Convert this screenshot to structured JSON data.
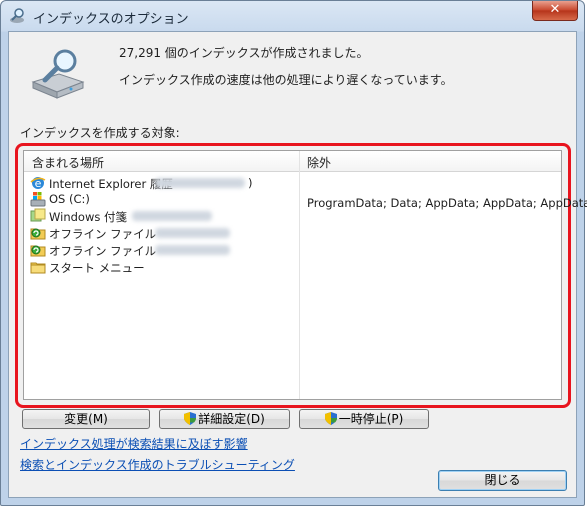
{
  "window": {
    "title": "インデックスのオプション",
    "close_label": "✕"
  },
  "summary": {
    "count_line": "27,291 個のインデックスが作成されました。",
    "speed_line": "インデックス作成の速度は他の処理により遅くなっています。"
  },
  "section_label": "インデックスを作成する対象:",
  "table": {
    "col_included": "含まれる場所",
    "col_excluded": "除外",
    "rows": [
      {
        "label": "Internet Explorer 履歴",
        "suffix": ")",
        "icon": "internet-explorer-icon"
      },
      {
        "label": "OS (C:)",
        "suffix": "",
        "icon": "windows-drive-icon",
        "excluded": "ProgramData; Data; AppData; AppData; AppData;..."
      },
      {
        "label": "Windows 付箋",
        "suffix": "",
        "icon": "sticky-notes-icon"
      },
      {
        "label": "オフライン ファイル",
        "suffix": "",
        "icon": "offline-files-icon"
      },
      {
        "label": "オフライン ファイル",
        "suffix": "",
        "icon": "offline-files-icon"
      },
      {
        "label": "スタート メニュー",
        "suffix": "",
        "icon": "folder-icon"
      }
    ]
  },
  "buttons": {
    "modify": "変更(M)",
    "advanced": "詳細設定(D)",
    "pause": "一時停止(P)",
    "close": "閉じる"
  },
  "links": {
    "effect": "インデックス処理が検索結果に及ぼす影響",
    "troubleshoot": "検索とインデックス作成のトラブルシューティング"
  }
}
